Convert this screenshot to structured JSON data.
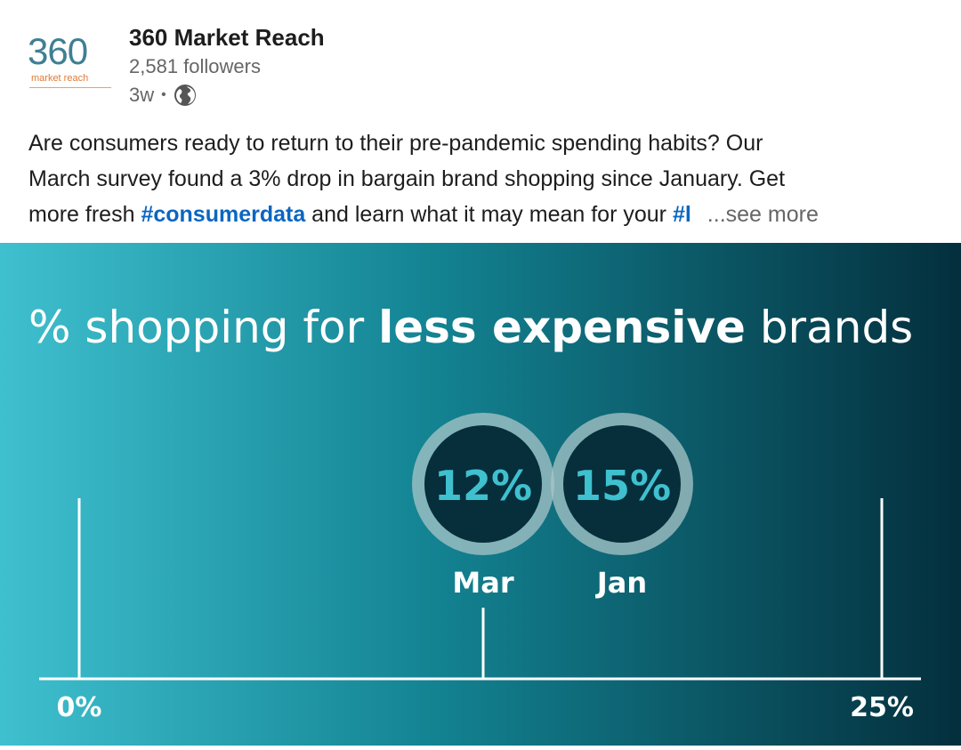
{
  "post": {
    "logo": {
      "number": "360",
      "tagline": "market reach"
    },
    "author": "360 Market Reach",
    "followers": "2,581 followers",
    "age": "3w",
    "separator": "•",
    "visibility_icon": "globe-icon",
    "text_line1": "Are consumers ready to return to their pre-pandemic spending habits? Our",
    "text_line2": "March survey found a 3% drop in bargain brand shopping since January. Get",
    "text_line3_before": "more fresh ",
    "hashtag1": "#consumerdata",
    "text_line3_after": " and learn what it may mean for your ",
    "hashtag2_truncated": "#l",
    "see_more": "...see more"
  },
  "infographic": {
    "title_part1": "% shopping for ",
    "title_bold": "less expensive",
    "title_part2": " brands",
    "colors": {
      "gradient_left": "#3fc0cf",
      "gradient_mid": "#138392",
      "gradient_right": "#042f3d",
      "circle_ring": "#a9c6c8",
      "circle_text": "#3fc0cf",
      "circle_fill": "#062e3b"
    },
    "scale": {
      "min": 0,
      "max": 25,
      "min_label": "0%",
      "max_label": "25%"
    },
    "points": [
      {
        "label": "Mar",
        "value": 12,
        "value_label": "12%"
      },
      {
        "label": "Jan",
        "value": 15,
        "value_label": "15%"
      }
    ]
  }
}
